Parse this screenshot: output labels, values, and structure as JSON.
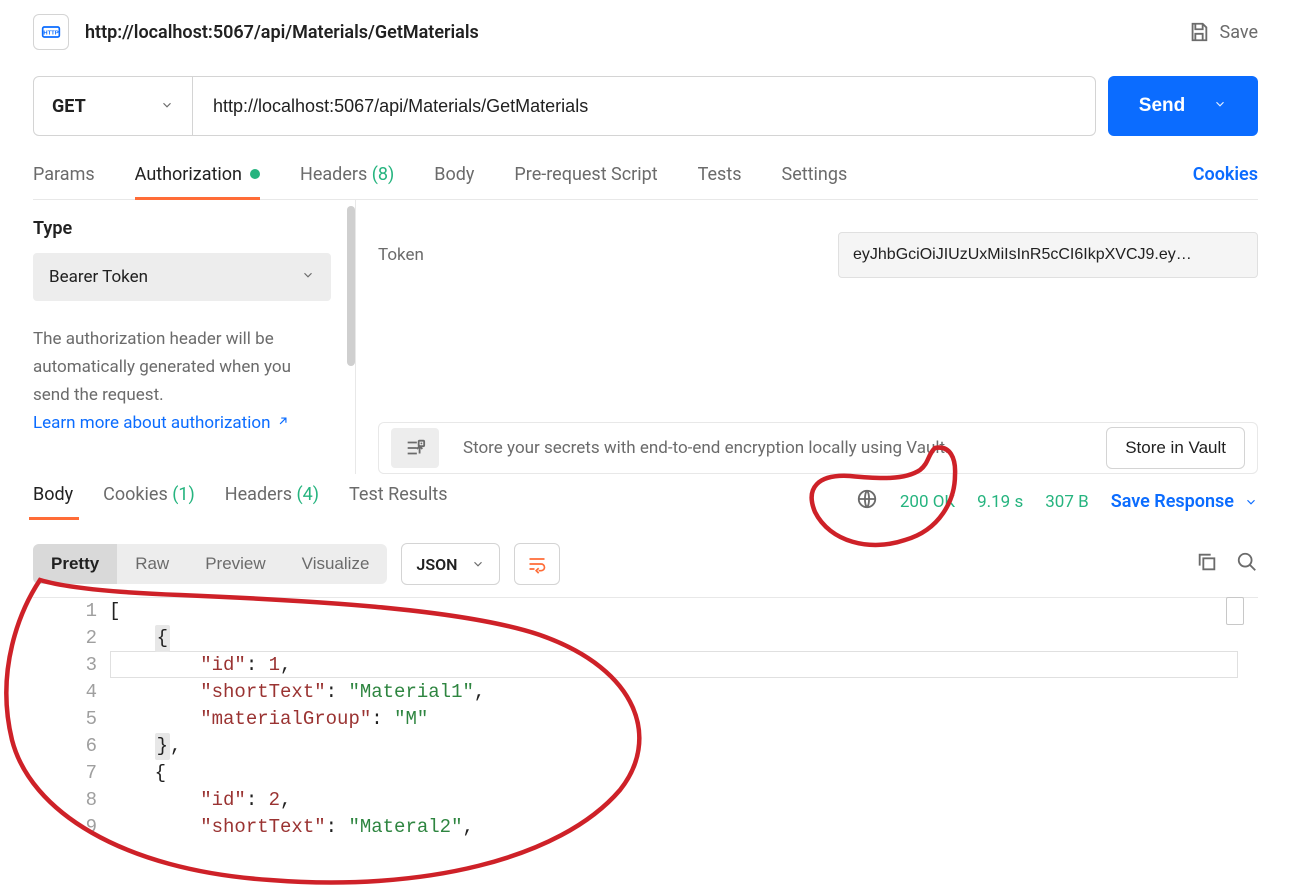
{
  "header": {
    "title": "http://localhost:5067/api/Materials/GetMaterials",
    "save_label": "Save"
  },
  "request": {
    "method": "GET",
    "url": "http://localhost:5067/api/Materials/GetMaterials",
    "send_label": "Send"
  },
  "request_tabs": {
    "params": "Params",
    "authorization": "Authorization",
    "headers": "Headers",
    "headers_count": "(8)",
    "body": "Body",
    "pre_request": "Pre-request Script",
    "tests": "Tests",
    "settings": "Settings",
    "cookies": "Cookies"
  },
  "auth": {
    "type_label": "Type",
    "type_value": "Bearer Token",
    "help_text": "The authorization header will be automatically generated when you send the request.",
    "help_link": "Learn more about authorization",
    "token_label": "Token",
    "token_value": "eyJhbGciOiJIUzUxMiIsInR5cCI6IkpXVCJ9.ey…"
  },
  "vault": {
    "message": "Store your secrets with end-to-end encryption locally using Vault.",
    "button": "Store in Vault"
  },
  "response_tabs": {
    "body": "Body",
    "cookies": "Cookies",
    "cookies_count": "(1)",
    "headers": "Headers",
    "headers_count": "(4)",
    "test_results": "Test Results"
  },
  "response_status": {
    "status": "200 OK",
    "time": "9.19 s",
    "size": "307 B",
    "save_response": "Save Response"
  },
  "pretty_bar": {
    "pretty": "Pretty",
    "raw": "Raw",
    "preview": "Preview",
    "visualize": "Visualize",
    "format": "JSON"
  },
  "response_body": {
    "lines": [
      {
        "n": 1,
        "raw": "["
      },
      {
        "n": 2,
        "raw": "    {"
      },
      {
        "n": 3,
        "raw": "        \"id\": 1,"
      },
      {
        "n": 4,
        "raw": "        \"shortText\": \"Material1\","
      },
      {
        "n": 5,
        "raw": "        \"materialGroup\": \"M\""
      },
      {
        "n": 6,
        "raw": "    },"
      },
      {
        "n": 7,
        "raw": "    {"
      },
      {
        "n": 8,
        "raw": "        \"id\": 2,"
      },
      {
        "n": 9,
        "raw": "        \"shortText\": \"Materal2\","
      }
    ]
  }
}
